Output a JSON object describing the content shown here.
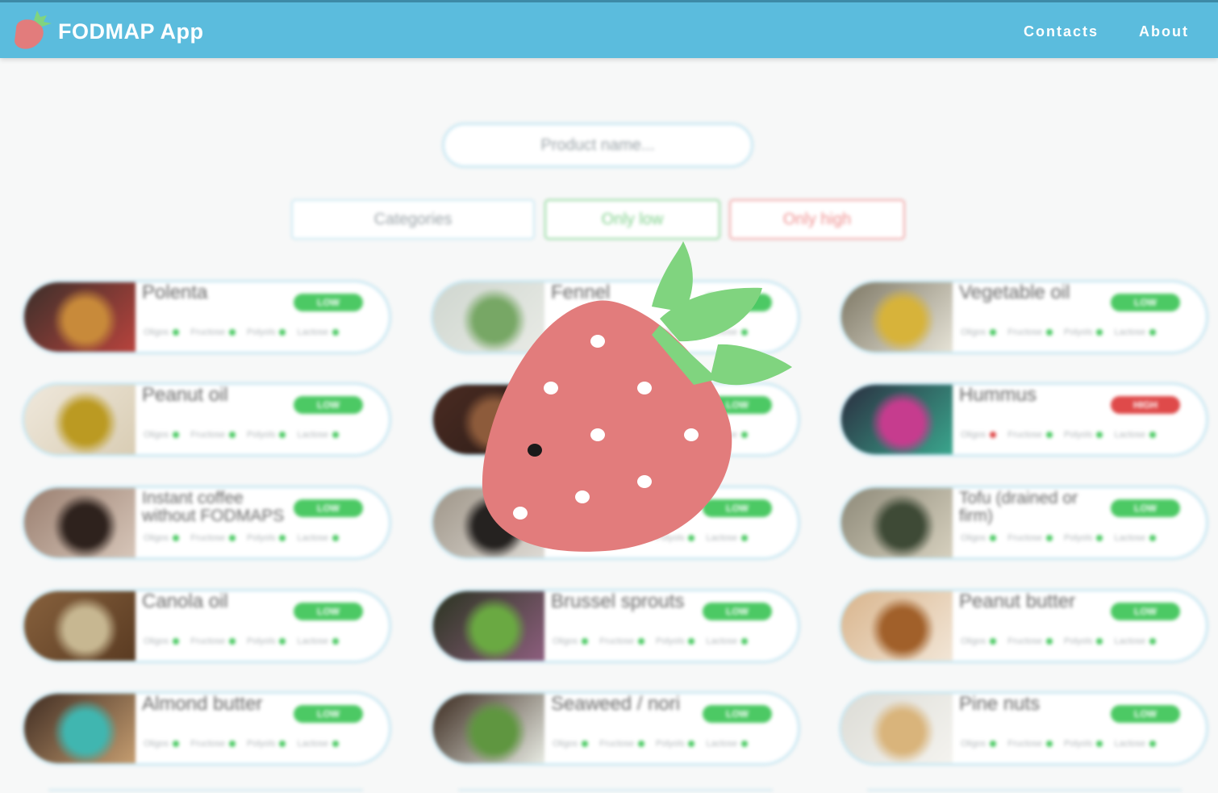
{
  "header": {
    "brand": "FODMAP App",
    "nav": [
      "Contacts",
      "About"
    ]
  },
  "search": {
    "placeholder": "Product name..."
  },
  "filters": {
    "categories": "Categories",
    "only_low": "Only low",
    "only_high": "Only high"
  },
  "prop_labels": [
    "Oligos",
    "Fructose",
    "Polyols",
    "Lactose"
  ],
  "colors": {
    "header": "#5bbcdd",
    "low": "#4cc964",
    "high": "#df4a4a",
    "logo": "#e27c7c",
    "leaf": "#80d47f"
  },
  "products": [
    {
      "name": "Polenta",
      "level": "LOW",
      "dots": [
        "low",
        "low",
        "low",
        "low"
      ],
      "img": [
        "#3a2f2a",
        "#c88a3a",
        "#b8433d"
      ]
    },
    {
      "name": "Fennel",
      "level": "LOW",
      "dots": [
        "low",
        "low",
        "low",
        "low"
      ],
      "img": [
        "#cfd6cf",
        "#77a765",
        "#e9ebe6"
      ]
    },
    {
      "name": "Vegetable oil",
      "level": "LOW",
      "dots": [
        "low",
        "low",
        "low",
        "low"
      ],
      "img": [
        "#7d7764",
        "#d7b33a",
        "#e6e3d7"
      ]
    },
    {
      "name": "Peanut oil",
      "level": "LOW",
      "dots": [
        "low",
        "low",
        "low",
        "low"
      ],
      "img": [
        "#efe8dc",
        "#bb9a22",
        "#d9cdb4"
      ]
    },
    {
      "name": "",
      "level": "LOW",
      "dots": [
        "low",
        "low",
        "low",
        "low"
      ],
      "img": [
        "#4a2b22",
        "#8d5b3b",
        "#2b1c17"
      ]
    },
    {
      "name": "Hummus",
      "level": "HIGH",
      "dots": [
        "high",
        "low",
        "low",
        "low"
      ],
      "img": [
        "#2a2d3f",
        "#c63c8e",
        "#3aa68d"
      ]
    },
    {
      "name": "Instant coffee without FODMAPS",
      "level": "LOW",
      "dots": [
        "low",
        "low",
        "low",
        "low"
      ],
      "img": [
        "#9a7f70",
        "#2e221d",
        "#d7c6b9"
      ]
    },
    {
      "name": "",
      "level": "LOW",
      "dots": [
        "low",
        "low",
        "low",
        "low"
      ],
      "img": [
        "#9e9588",
        "#252220",
        "#dedad4"
      ]
    },
    {
      "name": "Tofu (drained or firm)",
      "level": "LOW",
      "dots": [
        "low",
        "low",
        "low",
        "low"
      ],
      "img": [
        "#8e8a79",
        "#3e4a36",
        "#d6d0be"
      ]
    },
    {
      "name": "Canola oil",
      "level": "LOW",
      "dots": [
        "low",
        "low",
        "low",
        "low"
      ],
      "img": [
        "#87613d",
        "#c7b791",
        "#5a3b22"
      ]
    },
    {
      "name": "Brussel sprouts",
      "level": "LOW",
      "dots": [
        "low",
        "low",
        "low",
        "low"
      ],
      "img": [
        "#2a3420",
        "#6aa942",
        "#8d5e7e"
      ]
    },
    {
      "name": "Peanut butter",
      "level": "LOW",
      "dots": [
        "low",
        "low",
        "low",
        "low"
      ],
      "img": [
        "#d9b58d",
        "#a1602a",
        "#f2e6d7"
      ]
    },
    {
      "name": "Almond butter",
      "level": "LOW",
      "dots": [
        "low",
        "low",
        "low",
        "low"
      ],
      "img": [
        "#3f2c22",
        "#40b6b0",
        "#c59d70"
      ]
    },
    {
      "name": "Seaweed / nori",
      "level": "LOW",
      "dots": [
        "low",
        "low",
        "low",
        "low"
      ],
      "img": [
        "#3b2a1f",
        "#5f9640",
        "#e8ebe3"
      ]
    },
    {
      "name": "Pine nuts",
      "level": "LOW",
      "dots": [
        "low",
        "low",
        "low",
        "low"
      ],
      "img": [
        "#dcdcd6",
        "#d9b47b",
        "#f4f3ef"
      ]
    }
  ]
}
